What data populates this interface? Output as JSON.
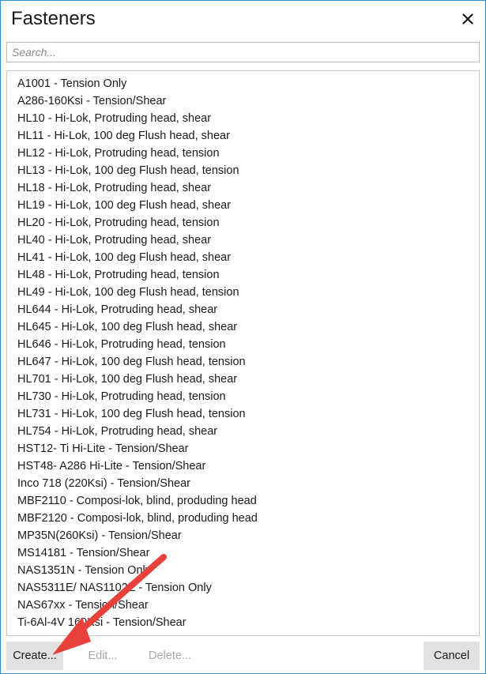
{
  "window": {
    "title": "Fasteners",
    "close_glyph": "✕"
  },
  "search": {
    "placeholder": "Search..."
  },
  "fasteners": [
    "A1001 - Tension Only",
    "A286-160Ksi - Tension/Shear",
    "HL10 - Hi-Lok, Protruding head, shear",
    "HL11 - Hi-Lok, 100 deg Flush head, shear",
    "HL12 - Hi-Lok, Protruding head, tension",
    "HL13 - Hi-Lok, 100 deg Flush head, tension",
    "HL18 - Hi-Lok, Protruding head, shear",
    "HL19 - Hi-Lok, 100 deg Flush head, shear",
    "HL20 - Hi-Lok, Protruding head, tension",
    "HL40 - Hi-Lok, Protruding head, shear",
    "HL41 - Hi-Lok, 100 deg Flush head, shear",
    "HL48 - Hi-Lok, Protruding head, tension",
    "HL49 - Hi-Lok, 100 deg Flush head, tension",
    "HL644 - Hi-Lok, Protruding head, shear",
    "HL645 - Hi-Lok, 100 deg Flush head, shear",
    "HL646 - Hi-Lok, Protruding head, tension",
    "HL647 - Hi-Lok, 100 deg Flush head, tension",
    "HL701 - Hi-Lok, 100 deg Flush head, shear",
    "HL730 - Hi-Lok, Protruding head, tension",
    "HL731 - Hi-Lok, 100 deg Flush head, tension",
    "HL754 - Hi-Lok, Protruding head, shear",
    "HST12- Ti Hi-Lite - Tension/Shear",
    "HST48- A286 Hi-Lite - Tension/Shear",
    "Inco 718 (220Ksi) - Tension/Shear",
    "MBF2110 - Composi-lok, blind, produding head",
    "MBF2120 - Composi-lok, blind, produding head",
    "MP35N(260Ksi) - Tension/Shear",
    "MS14181 - Tension/Shear",
    "NAS1351N - Tension Only",
    "NAS5311E/ NAS1102E - Tension Only",
    "NAS67xx - Tension/Shear",
    "Ti-6Al-4V 160Ksi - Tension/Shear"
  ],
  "footer": {
    "create_label": "Create...",
    "edit_label": "Edit...",
    "delete_label": "Delete...",
    "cancel_label": "Cancel"
  },
  "annotation": {
    "arrow_color": "#e8403a",
    "points_to": "create-button"
  }
}
